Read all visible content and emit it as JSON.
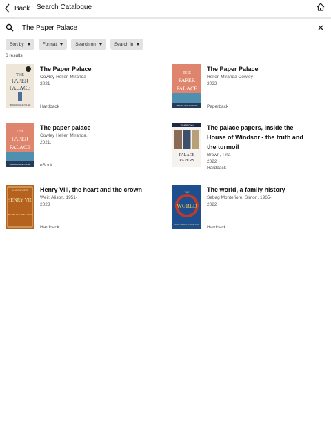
{
  "header": {
    "back_label": "Back",
    "title": "Search Catalogue"
  },
  "search": {
    "query": "The Paper Palace",
    "placeholder": "Search"
  },
  "filters": [
    {
      "label": "Sort by"
    },
    {
      "label": "Format"
    },
    {
      "label": "Search on"
    },
    {
      "label": "Search in"
    }
  ],
  "results_count": "6 results",
  "results": [
    {
      "title": "The Paper Palace",
      "author": "Cowley Heller, Miranda",
      "year": "2021",
      "format": "Hardback",
      "cover": {
        "top": "THE",
        "mid": "PAPER",
        "bot": "PALACE",
        "footer": "MIRANDA COWLEY HELLER",
        "bg": "#eee6d8",
        "fg": "#2a3a52"
      }
    },
    {
      "title": "The Paper Palace",
      "author": "Heller, Miranda Cowley",
      "year": "2022",
      "format": "Paperback",
      "cover": {
        "top": "THE",
        "mid": "PAPER",
        "bot": "PALACE",
        "footer": "MIRANDA COWLEY HELLER",
        "bg": "#e0856d",
        "fg": "#ffffff"
      }
    },
    {
      "title": "The paper palace",
      "author": "Cowley Heller, Miranda.",
      "year": "2021.",
      "format": "eBook",
      "cover": {
        "top": "THE",
        "mid": "PAPER",
        "bot": "PALACE",
        "footer": "MIRANDA COWLEY HELLER",
        "bg": "#e0856d",
        "fg": "#ffffff"
      }
    },
    {
      "title_lines": [
        "The palace papers, inside the",
        "House of Windsor - the truth and",
        "the turmoil"
      ],
      "author": "Brown, Tina",
      "year": "2022",
      "format": "Hardback",
      "cover": {
        "top": "TINA BROWN",
        "mid": "PALACE",
        "bot": "PAPERS",
        "footer": "",
        "bg": "#f6f3ee",
        "fg": "#1e2a44"
      }
    },
    {
      "title": "Henry VIII, the heart and the crown",
      "author": "Weir, Alison, 1951-",
      "year": "2023",
      "format": "Hardback",
      "cover": {
        "top": "ALISON WEIR",
        "mid": "HENRY VIII",
        "bot": "THE HEART & THE CROWN",
        "footer": "",
        "bg": "#b5621e",
        "fg": "#f5e2a8"
      }
    },
    {
      "title": "The world, a family history",
      "author": "Sebag Montefiore, Simon, 1965-",
      "year": "2022",
      "format": "Hardback",
      "cover": {
        "top": "THE",
        "mid": "WORLD",
        "bot": "SIMON SEBAG MONTEFIORE",
        "footer": "",
        "bg": "#1d4f8f",
        "fg": "#f3c94a"
      }
    }
  ]
}
